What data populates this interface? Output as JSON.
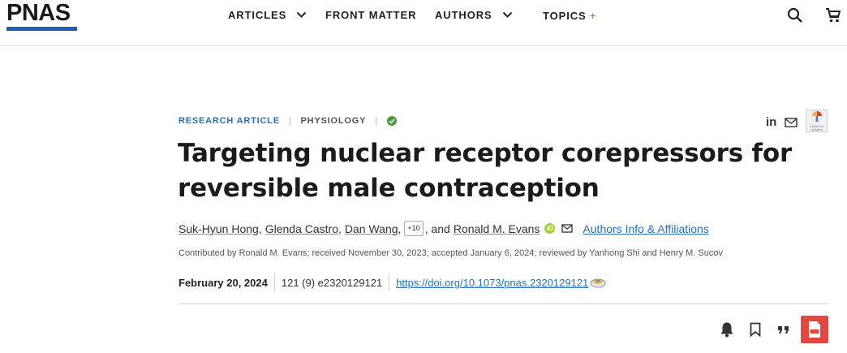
{
  "header": {
    "logo_text": "PNAS",
    "brand_color": "#1f5fb0",
    "nav": [
      {
        "label": "ARTICLES",
        "has_dropdown": true
      },
      {
        "label": "FRONT MATTER",
        "has_dropdown": false
      },
      {
        "label": "AUTHORS",
        "has_dropdown": true
      },
      {
        "label": "TOPICS",
        "suffix": "+"
      }
    ],
    "icons": [
      "search-icon",
      "cart-icon"
    ]
  },
  "article": {
    "type": "RESEARCH ARTICLE",
    "subject": "PHYSIOLOGY",
    "open_access_icon": "check-circle-icon",
    "share": {
      "linkedin": "in",
      "email_icon": "mail-icon",
      "crossmark_label": "Check for updates"
    },
    "title_line1": "Targeting nuclear receptor corepressors for",
    "title_line2": "reversible male contraception",
    "authors": {
      "a1": "Suk-Hyun Hong",
      "sep1": ",",
      "a2": "Glenda Castro",
      "sep2": ",",
      "a3": "Dan Wang",
      "sep3": ",",
      "more": "+10",
      "sep4": ", and",
      "a4": "Ronald M. Evans",
      "orcid": "iD",
      "affiliations_link": "Authors Info & Affiliations"
    },
    "contrib_line": "Contributed by Ronald M. Evans; received November 30, 2023; accepted January 6, 2024; reviewed by Yanhong Shi and Henry M. Sucov",
    "pub_date": "February 20, 2024",
    "citation": "121 (9) e2320129121",
    "doi": "https://doi.org/10.1073/pnas.2320129121"
  },
  "toolbar": {
    "icons": [
      "bell-icon",
      "bookmark-icon",
      "quote-icon",
      "pdf-icon"
    ],
    "pdf_color": "#e0483f",
    "pdf_label": "PDF"
  }
}
